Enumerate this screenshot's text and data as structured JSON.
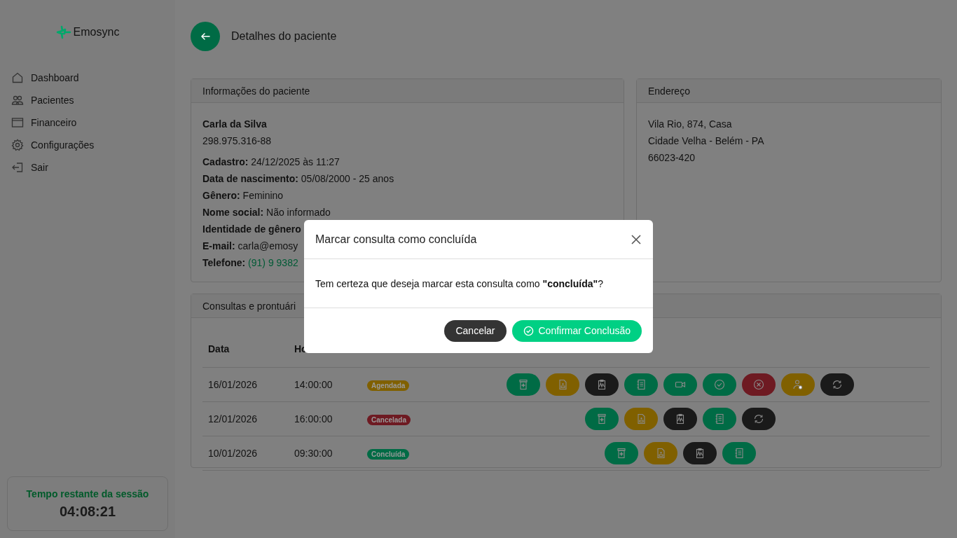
{
  "sidebar": {
    "brand": "Emosync",
    "items": [
      {
        "label": "Dashboard"
      },
      {
        "label": "Pacientes"
      },
      {
        "label": "Financeiro"
      },
      {
        "label": "Configurações"
      },
      {
        "label": "Sair"
      }
    ],
    "session": {
      "label": "Tempo restante da sessão",
      "time": "04:08:21"
    }
  },
  "page": {
    "title": "Detalhes do paciente"
  },
  "patient_card": {
    "title": "Informações do paciente",
    "name": "Carla da Silva",
    "document": "298.975.316-88",
    "fields": [
      {
        "label": "Cadastro:",
        "value": "24/12/2025 às 11:27",
        "kind": "text"
      },
      {
        "label": "Data de nascimento:",
        "value": "05/08/2000 - 25 anos",
        "kind": "text"
      },
      {
        "label": "Gênero:",
        "value": "Feminino",
        "kind": "text"
      },
      {
        "label": "Nome social:",
        "value": "Não informado",
        "kind": "text"
      },
      {
        "label": "Identidade de gênero"
      },
      {
        "label": "E-mail:",
        "value": "carla@emosy",
        "kind": "text"
      },
      {
        "label": "Telefone:",
        "value": "(91) 9 9382",
        "kind": "phone"
      }
    ]
  },
  "address_card": {
    "title": "Endereço",
    "lines": [
      "Vila Rio, 874, Casa",
      "Cidade Velha - Belém - PA",
      "66023-420"
    ]
  },
  "appointments": {
    "title": "Consultas e prontuári",
    "columns": [
      "Data",
      "Ho"
    ],
    "rows": [
      {
        "date": "16/01/2026",
        "time": "14:00:00",
        "status": {
          "label": "Agendada",
          "color": "#806000"
        },
        "actions": [
          {
            "kind": "prescription",
            "color": "#006b45"
          },
          {
            "kind": "document",
            "color": "#806000"
          },
          {
            "kind": "report",
            "color": "#1a1a1a"
          },
          {
            "kind": "notes",
            "color": "#006b45"
          },
          {
            "kind": "video",
            "color": "#006b45"
          },
          {
            "kind": "complete",
            "color": "#006b45"
          },
          {
            "kind": "cancel",
            "color": "#6e1a22"
          },
          {
            "kind": "user",
            "color": "#806000"
          },
          {
            "kind": "reschedule",
            "color": "#1a1a1a"
          }
        ]
      },
      {
        "date": "12/01/2026",
        "time": "16:00:00",
        "status": {
          "label": "Cancelada",
          "color": "#6e1a22"
        },
        "actions": [
          {
            "kind": "prescription",
            "color": "#006b45"
          },
          {
            "kind": "document",
            "color": "#806000"
          },
          {
            "kind": "report",
            "color": "#1a1a1a"
          },
          {
            "kind": "notes",
            "color": "#006b45"
          },
          {
            "kind": "reschedule",
            "color": "#1a1a1a"
          }
        ]
      },
      {
        "date": "10/01/2026",
        "time": "09:30:00",
        "status": {
          "label": "Concluída",
          "color": "#006b45"
        },
        "actions": [
          {
            "kind": "prescription",
            "color": "#006b45"
          },
          {
            "kind": "document",
            "color": "#806000"
          },
          {
            "kind": "report",
            "color": "#1a1a1a"
          },
          {
            "kind": "notes",
            "color": "#006b45"
          }
        ]
      }
    ]
  },
  "modal": {
    "title": "Marcar consulta como concluída",
    "message": "Tem certeza que deseja marcar esta consulta como **\"concluída\"**?",
    "buttons": [
      {
        "label": "Cancelar",
        "kind": "secondary"
      },
      {
        "label": "Confirmar Conclusão",
        "kind": "primary"
      }
    ]
  }
}
